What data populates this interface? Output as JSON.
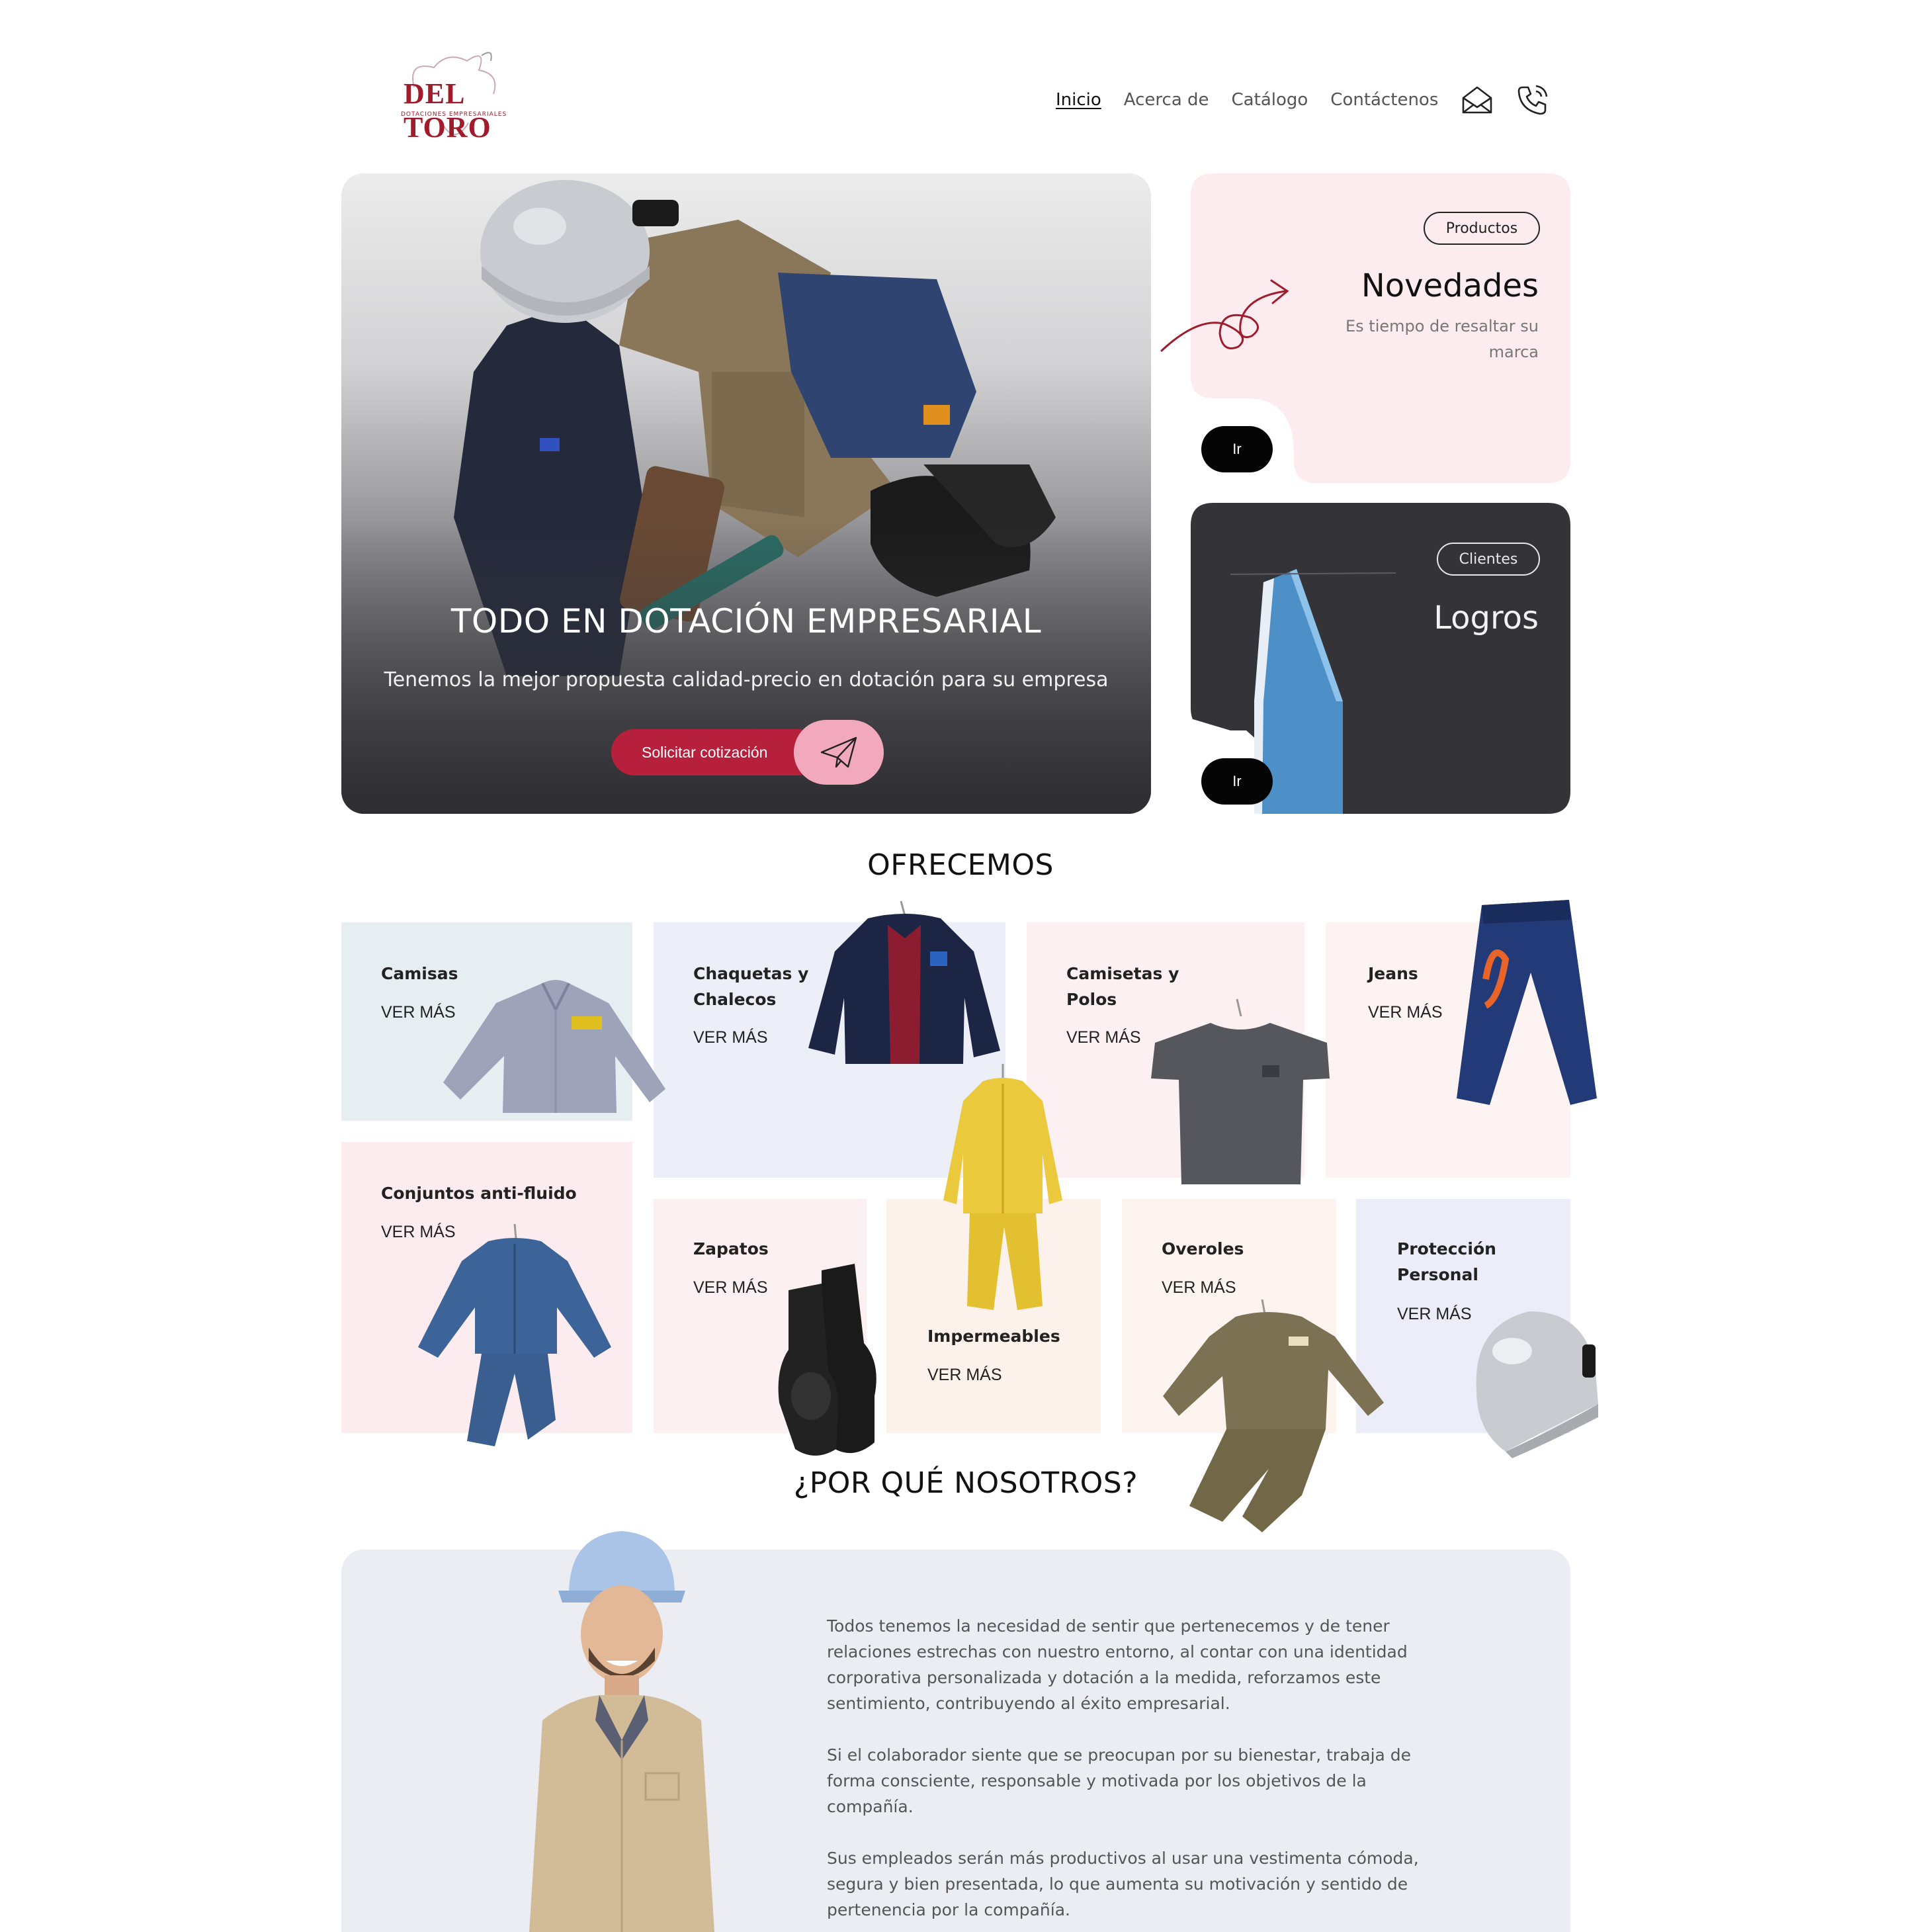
{
  "brand": {
    "name": "DEL TORO",
    "tagline": "DOTACIONES EMPRESARIALES",
    "accent": "#b7203c",
    "dark": "#2d2d31"
  },
  "nav": {
    "items": [
      {
        "label": "Inicio",
        "active": true
      },
      {
        "label": "Acerca de",
        "active": false
      },
      {
        "label": "Catálogo",
        "active": false
      },
      {
        "label": "Contáctenos",
        "active": false
      }
    ],
    "icons": [
      "envelope-icon",
      "phone-icon"
    ]
  },
  "hero": {
    "title": "TODO EN DOTACIÓN EMPRESARIAL",
    "subtitle": "Tenemos la mejor propuesta calidad-precio en dotación para su empresa",
    "cta_label": "Solicitar cotización",
    "cta_icon": "paper-plane-icon"
  },
  "cards": {
    "novedades": {
      "tag": "Productos",
      "title": "Novedades",
      "description": "Es tiempo de resaltar su marca",
      "button": "Ir",
      "bg": "#fcecef"
    },
    "logros": {
      "tag": "Clientes",
      "title": "Logros",
      "button": "Ir",
      "bg": "#343438"
    }
  },
  "offer": {
    "title": "OFRECEMOS",
    "more_label": "VER MÁS",
    "categories": [
      {
        "label": "Camisas",
        "bg": "#e7eef1"
      },
      {
        "label": "Chaquetas y Chalecos",
        "bg": "#eceff8"
      },
      {
        "label": "Camisetas y Polos",
        "bg": "#fdf0f2"
      },
      {
        "label": "Jeans",
        "bg": "#fdf3f2"
      },
      {
        "label": "Conjuntos anti-fluido",
        "bg": "#fcecef"
      },
      {
        "label": "Zapatos",
        "bg": "#fdf0f2"
      },
      {
        "label": "Impermeables",
        "bg": "#fdf1ec"
      },
      {
        "label": "Overoles",
        "bg": "#fdf3ef"
      },
      {
        "label": "Protección Personal",
        "bg": "#ecedf8"
      }
    ]
  },
  "why": {
    "title": "¿POR QUÉ NOSOTROS?",
    "paragraphs": [
      "Todos tenemos la necesidad de sentir que pertenecemos y de tener relaciones estrechas con nuestro entorno, al contar con una identidad corporativa personalizada y dotación a la medida, reforzamos este sentimiento, contribuyendo al éxito empresarial.",
      "Si el colaborador siente que se preocupan por su bienestar, trabaja de forma consciente, responsable y motivada por los objetivos de la compañía.",
      "Sus empleados serán más productivos al usar una vestimenta cómoda, segura y bien presentada, lo que aumenta su motivación y sentido de pertenencia por la compañía."
    ]
  }
}
